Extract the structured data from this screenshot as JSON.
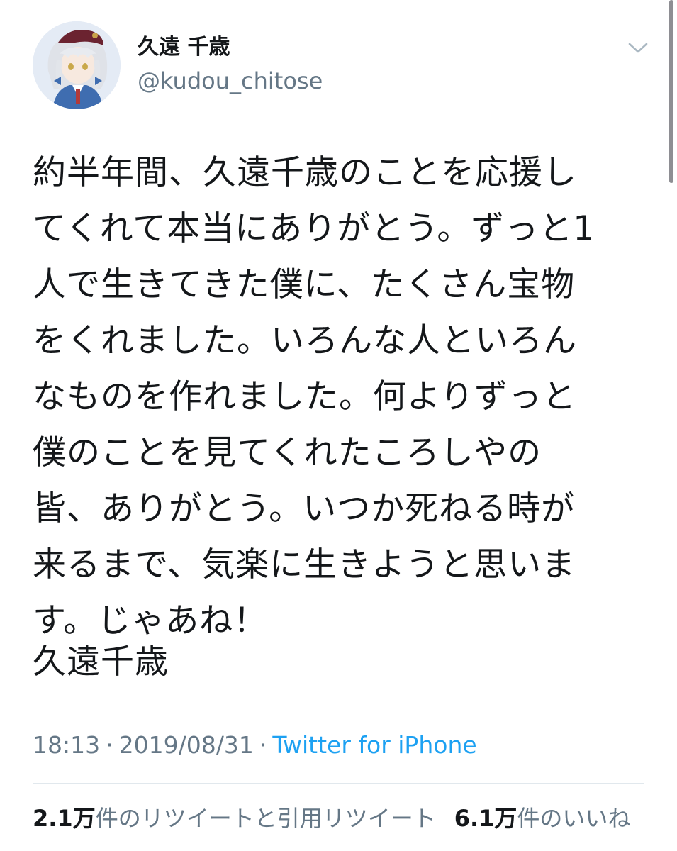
{
  "author": {
    "display_name": "久遠 千歳",
    "handle": "@kudou_chitose",
    "avatar_icon": "avatar-illustration"
  },
  "tweet": {
    "lines": [
      "約半年間、久遠千歳のことを応援し",
      "てくれて本当にありがとう。ずっと1",
      "人で生きてきた僕に、たくさん宝物",
      "をくれました。いろんな人といろん",
      "なものを作れました。何よりずっと",
      "僕のことを見てくれたころしやの",
      "皆、ありがとう。いつか死ねる時が",
      "来るまで、気楽に生きようと思いま",
      "す。じゃあね！"
    ],
    "signature": "久遠千歳"
  },
  "meta": {
    "time": "18:13",
    "separator": "·",
    "date": "2019/08/31",
    "source": "Twitter for iPhone"
  },
  "stats": {
    "retweets_count": "2.1万",
    "retweets_label": "件のリツイートと引用リツイート",
    "likes_count": "6.1万",
    "likes_label": "件のいいね"
  },
  "icons": {
    "more": "chevron-down-icon"
  },
  "colors": {
    "text": "#14171a",
    "secondary": "#657786",
    "link": "#1da1f2",
    "divider": "#e1e8ed"
  }
}
